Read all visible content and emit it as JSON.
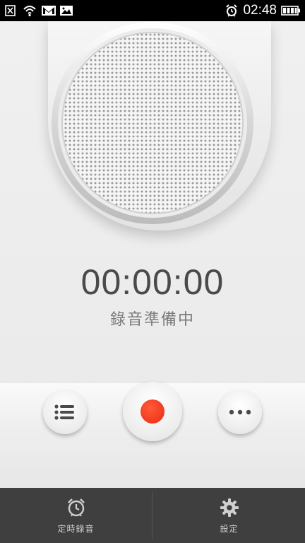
{
  "status_bar": {
    "time": "02:48",
    "left_icons": [
      "close-box-icon",
      "wifi-icon",
      "gmail-icon",
      "image-icon"
    ],
    "right_icons": [
      "alarm-icon",
      "battery-icon"
    ]
  },
  "recorder": {
    "timer": "00:00:00",
    "status": "錄音準備中"
  },
  "controls": {
    "list": "list-icon",
    "record": "record-icon",
    "more": "more-icon"
  },
  "bottom_bar": {
    "tabs": [
      {
        "label": "定時錄音",
        "icon": "alarm-clock-icon"
      },
      {
        "label": "設定",
        "icon": "gear-icon"
      }
    ]
  },
  "colors": {
    "record": "#ea2a10",
    "bottom_bar": "#3f3f3f",
    "status_bar": "#000000"
  }
}
